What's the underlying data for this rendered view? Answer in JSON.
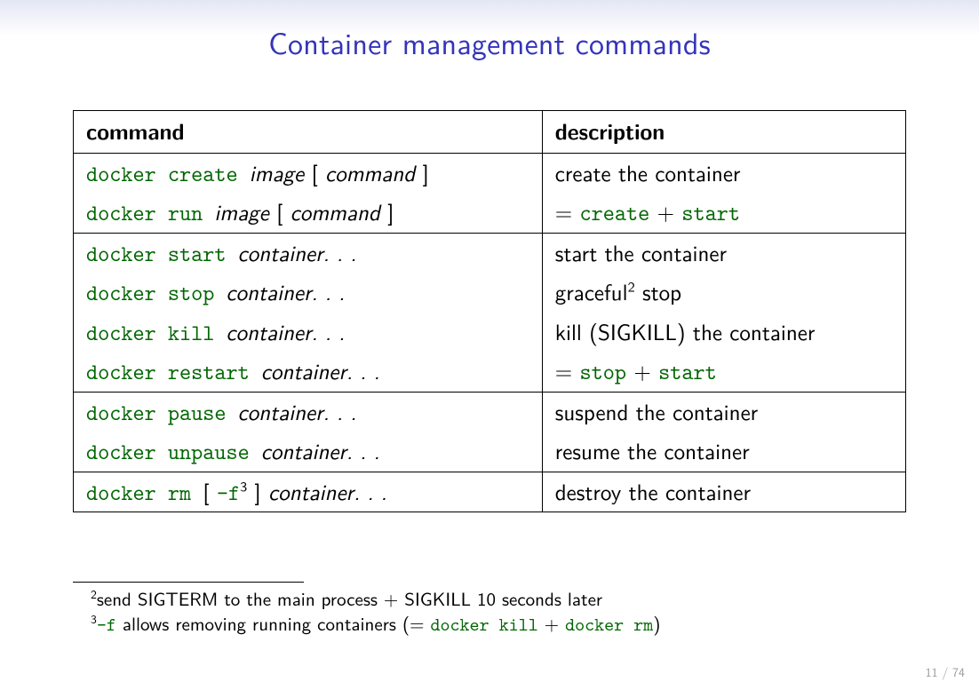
{
  "title": "Container management commands",
  "table": {
    "headers": {
      "cmd": "command",
      "desc": "description"
    },
    "rows": [
      {
        "cmd_tt": "docker create ",
        "cmd_arg": "image",
        "cmd_tail_plain": " [ ",
        "cmd_arg2": "command",
        "cmd_close_plain": " ]",
        "desc_pre": "create the container",
        "desc_tt": "",
        "desc_mid": "",
        "desc_tt2": "",
        "desc_post": "",
        "sup": ""
      },
      {
        "cmd_tt": "docker run ",
        "cmd_arg": "image",
        "cmd_tail_plain": " [ ",
        "cmd_arg2": "command",
        "cmd_close_plain": " ]",
        "desc_pre": "= ",
        "desc_tt": "create",
        "desc_mid": " + ",
        "desc_tt2": "start",
        "desc_post": "",
        "sup": ""
      },
      {
        "cmd_tt": "docker start ",
        "cmd_arg": "container. . .",
        "cmd_tail_plain": "",
        "cmd_arg2": "",
        "cmd_close_plain": "",
        "desc_pre": "start the container",
        "desc_tt": "",
        "desc_mid": "",
        "desc_tt2": "",
        "desc_post": "",
        "sup": ""
      },
      {
        "cmd_tt": "docker stop ",
        "cmd_arg": "container. . .",
        "cmd_tail_plain": "",
        "cmd_arg2": "",
        "cmd_close_plain": "",
        "desc_pre": "graceful",
        "desc_tt": "",
        "desc_mid": "",
        "desc_tt2": "",
        "desc_post": " stop",
        "sup": "2"
      },
      {
        "cmd_tt": "docker kill ",
        "cmd_arg": "container. . .",
        "cmd_tail_plain": "",
        "cmd_arg2": "",
        "cmd_close_plain": "",
        "desc_pre": "kill (SIGKILL) the container",
        "desc_tt": "",
        "desc_mid": "",
        "desc_tt2": "",
        "desc_post": "",
        "sup": ""
      },
      {
        "cmd_tt": "docker restart ",
        "cmd_arg": "container. . .",
        "cmd_tail_plain": "",
        "cmd_arg2": "",
        "cmd_close_plain": "",
        "desc_pre": "= ",
        "desc_tt": "stop",
        "desc_mid": " + ",
        "desc_tt2": "start",
        "desc_post": "",
        "sup": ""
      },
      {
        "cmd_tt": "docker pause ",
        "cmd_arg": "container. . .",
        "cmd_tail_plain": "",
        "cmd_arg2": "",
        "cmd_close_plain": "",
        "desc_pre": "suspend the container",
        "desc_tt": "",
        "desc_mid": "",
        "desc_tt2": "",
        "desc_post": "",
        "sup": ""
      },
      {
        "cmd_tt": "docker unpause ",
        "cmd_arg": "container. . .",
        "cmd_tail_plain": "",
        "cmd_arg2": "",
        "cmd_close_plain": "",
        "desc_pre": "resume the container",
        "desc_tt": "",
        "desc_mid": "",
        "desc_tt2": "",
        "desc_post": "",
        "sup": ""
      },
      {
        "cmd_tt": "docker rm ",
        "cmd_arg": "",
        "cmd_tail_plain": "[ ",
        "cmd_flag_tt": "-f",
        "cmd_flag_sup": "3",
        "cmd_mid_plain": " ] ",
        "cmd_arg2": "container. . .",
        "cmd_close_plain": "",
        "desc_pre": "destroy the container",
        "desc_tt": "",
        "desc_mid": "",
        "desc_tt2": "",
        "desc_post": "",
        "sup": ""
      }
    ]
  },
  "footnotes": {
    "f2": {
      "num": "2",
      "pre": "send SIGTERM to the main process + SIGKILL 10 seconds later",
      "tt1": "",
      "mid": "",
      "tt2": "",
      "post": ""
    },
    "f3": {
      "num": "3",
      "flag_tt": "-f",
      "pre": " allows removing running containers (= ",
      "tt1": "docker kill",
      "mid": " + ",
      "tt2": "docker rm",
      "post": ")"
    }
  },
  "pagenum": "11 / 74"
}
